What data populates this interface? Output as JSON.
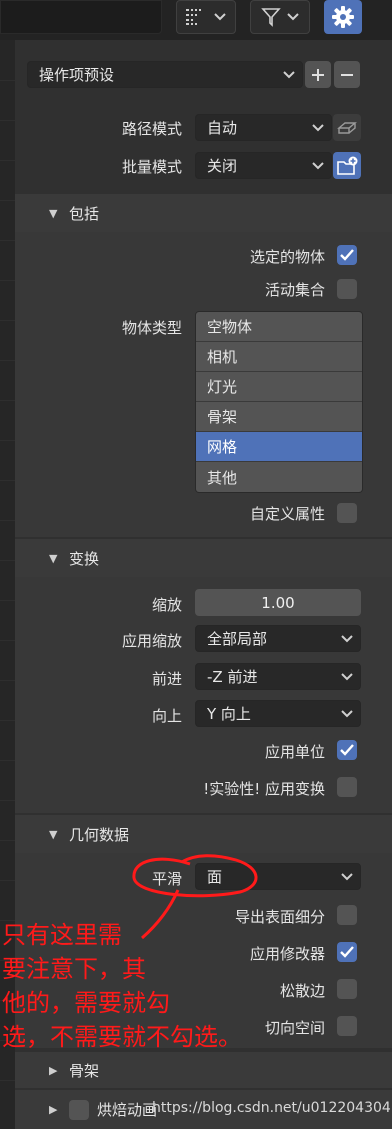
{
  "header": {
    "icons": [
      "list-icon",
      "filter-icon",
      "gear-icon"
    ]
  },
  "presets": {
    "label": "操作项预设"
  },
  "path_mode": {
    "label": "路径模式",
    "value": "自动"
  },
  "batch_mode": {
    "label": "批量模式",
    "value": "关闭"
  },
  "include": {
    "title": "包括",
    "selected_objects": {
      "label": "选定的物体",
      "checked": true
    },
    "active_collection": {
      "label": "活动集合",
      "checked": false
    },
    "object_types_label": "物体类型",
    "object_types": [
      {
        "label": "空物体",
        "selected": false
      },
      {
        "label": "相机",
        "selected": false
      },
      {
        "label": "灯光",
        "selected": false
      },
      {
        "label": "骨架",
        "selected": false
      },
      {
        "label": "网格",
        "selected": true
      },
      {
        "label": "其他",
        "selected": false
      }
    ],
    "custom_props": {
      "label": "自定义属性",
      "checked": false
    }
  },
  "transform": {
    "title": "变换",
    "scale": {
      "label": "缩放",
      "value": "1.00"
    },
    "apply_scale": {
      "label": "应用缩放",
      "value": "全部局部"
    },
    "forward": {
      "label": "前进",
      "value": "-Z 前进"
    },
    "up": {
      "label": "向上",
      "value": "Y 向上"
    },
    "apply_unit": {
      "label": "应用单位",
      "checked": true
    },
    "apply_transform": {
      "label": "!实验性! 应用变换",
      "checked": false
    }
  },
  "geometry": {
    "title": "几何数据",
    "smoothing": {
      "label": "平滑",
      "value": "面"
    },
    "subdiv": {
      "label": "导出表面细分",
      "checked": false
    },
    "modifiers": {
      "label": "应用修改器",
      "checked": true
    },
    "loose_edges": {
      "label": "松散边",
      "checked": false
    },
    "tangent_space": {
      "label": "切向空间",
      "checked": false
    }
  },
  "armature": {
    "title": "骨架"
  },
  "bake_anim": {
    "title": "烘焙动画",
    "checked": false
  },
  "annotation": {
    "lines": [
      "只有这里需",
      "要注意下，其",
      "他的，需要就勾",
      "选，不需要就不勾选。"
    ],
    "color": "#ff1a1a"
  },
  "watermark": "https://blog.csdn.net/u012204304",
  "colors": {
    "accent": "#4f72b8",
    "panel": "#383838",
    "background": "#303030"
  }
}
